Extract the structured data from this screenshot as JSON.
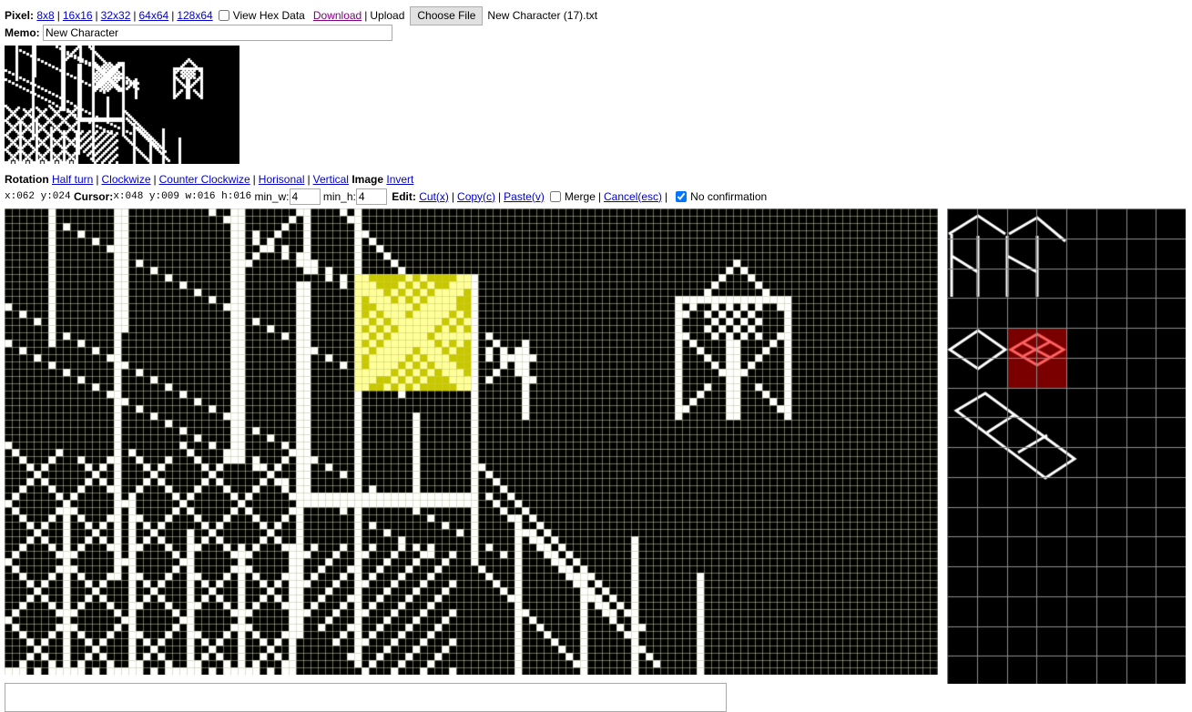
{
  "pixel": {
    "label": "Pixel:",
    "sizes": [
      "8x8",
      "16x16",
      "32x32",
      "64x64",
      "128x64"
    ],
    "view_hex_label": "View Hex Data",
    "view_hex_checked": false,
    "download_label": "Download",
    "upload_label": "Upload",
    "choose_file_label": "Choose File",
    "file_name": "New Character (17).txt"
  },
  "memo": {
    "label": "Memo:",
    "value": "New Character"
  },
  "rotation": {
    "label": "Rotation",
    "items": [
      "Half turn",
      "Clockwize",
      "Counter Clockwize",
      "Horisonal",
      "Vertical"
    ],
    "image_label": "Image",
    "invert_label": "Invert"
  },
  "status": {
    "coords": "x:062 y:024",
    "cursor_label": "Cursor:",
    "cursor": "x:048 y:009 w:016 h:016",
    "min_w_label": "min_w:",
    "min_w_value": "4",
    "min_h_label": "min_h:",
    "min_h_value": "4"
  },
  "edit": {
    "label": "Edit:",
    "cut_label": "Cut(x)",
    "copy_label": "Copy(c)",
    "paste_label": "Paste(v)",
    "merge_label": "Merge",
    "merge_checked": false,
    "cancel_label": "Cancel(esc)",
    "no_confirm_label": "No confirmation",
    "no_confirm_checked": true
  },
  "colors": {
    "pixel_on": "#ffffff",
    "pixel_off": "#000000",
    "grid_main": "#c8c878",
    "grid_side": "#8c8c8c",
    "selection": "#ffff00",
    "side_selection": "#ff0000",
    "link": "#0000cc"
  }
}
